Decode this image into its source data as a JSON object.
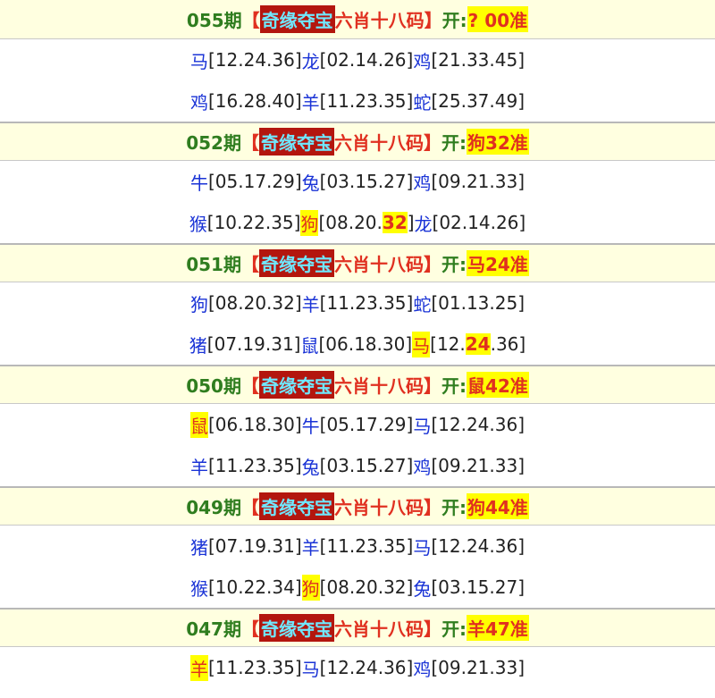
{
  "bracket_left": "【",
  "bracket_right": "】",
  "brand": "奇缘夺宝",
  "prize_title": "六肖十八码",
  "open_label": "开:",
  "colors": {
    "header_bg": "#ffffe0",
    "period": "#2f7d1f",
    "red": "#e03020",
    "brand_bg": "#b3160e",
    "brand_text": "#6fe8ff",
    "highlight": "#ffff00",
    "animal": "#1a33d6"
  },
  "records": [
    {
      "period": "055期",
      "result": "? 00准",
      "rows": [
        [
          {
            "animal": "马",
            "nums": "[12.24.36]"
          },
          {
            "animal": "龙",
            "nums": "[02.14.26]"
          },
          {
            "animal": "鸡",
            "nums": "[21.33.45]"
          }
        ],
        [
          {
            "animal": "鸡",
            "nums": "[16.28.40]"
          },
          {
            "animal": "羊",
            "nums": "[11.23.35]"
          },
          {
            "animal": "蛇",
            "nums": "[25.37.49]"
          }
        ]
      ]
    },
    {
      "period": "052期",
      "result": "狗32准",
      "rows": [
        [
          {
            "animal": "牛",
            "nums": "[05.17.29]"
          },
          {
            "animal": "兔",
            "nums": "[03.15.27]"
          },
          {
            "animal": "鸡",
            "nums": "[09.21.33]"
          }
        ],
        [
          {
            "animal": "猴",
            "nums": "[10.22.35]"
          },
          {
            "animal": "狗",
            "hl": true,
            "pre": "[08.20.",
            "hit": "32",
            "post": "]"
          },
          {
            "animal": "龙",
            "nums": "[02.14.26]"
          }
        ]
      ]
    },
    {
      "period": "051期",
      "result": "马24准",
      "rows": [
        [
          {
            "animal": "狗",
            "nums": "[08.20.32]"
          },
          {
            "animal": "羊",
            "nums": "[11.23.35]"
          },
          {
            "animal": "蛇",
            "nums": "[01.13.25]"
          }
        ],
        [
          {
            "animal": "猪",
            "nums": "[07.19.31]"
          },
          {
            "animal": "鼠",
            "nums": "[06.18.30]"
          },
          {
            "animal": "马",
            "hl": true,
            "pre": "[12.",
            "hit": "24",
            "post": ".36]"
          }
        ]
      ]
    },
    {
      "period": "050期",
      "result": "鼠42准",
      "rows": [
        [
          {
            "animal": "鼠",
            "hl": true,
            "nums": "[06.18.30]"
          },
          {
            "animal": "牛",
            "nums": "[05.17.29]"
          },
          {
            "animal": "马",
            "nums": "[12.24.36]"
          }
        ],
        [
          {
            "animal": "羊",
            "nums": "[11.23.35]"
          },
          {
            "animal": "兔",
            "nums": "[03.15.27]"
          },
          {
            "animal": "鸡",
            "nums": "[09.21.33]"
          }
        ]
      ]
    },
    {
      "period": "049期",
      "result": "狗44准",
      "rows": [
        [
          {
            "animal": "猪",
            "nums": "[07.19.31]"
          },
          {
            "animal": "羊",
            "nums": "[11.23.35]"
          },
          {
            "animal": "马",
            "nums": "[12.24.36]"
          }
        ],
        [
          {
            "animal": "猴",
            "nums": "[10.22.34]"
          },
          {
            "animal": "狗",
            "hl": true,
            "nums": "[08.20.32]"
          },
          {
            "animal": "兔",
            "nums": "[03.15.27]"
          }
        ]
      ]
    },
    {
      "period": "047期",
      "result": "羊47准",
      "rows": [
        [
          {
            "animal": "羊",
            "hl": true,
            "nums": "[11.23.35]"
          },
          {
            "animal": "马",
            "nums": "[12.24.36]"
          },
          {
            "animal": "鸡",
            "nums": "[09.21.33]"
          }
        ]
      ]
    }
  ]
}
